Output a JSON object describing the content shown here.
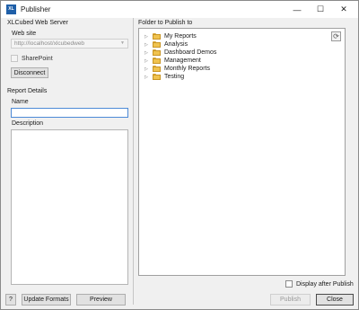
{
  "window": {
    "title": "Publisher",
    "app_icon": "XL",
    "icons": {
      "minimize": "minimize-icon",
      "maximize": "maximize-icon",
      "close": "close-icon"
    }
  },
  "server": {
    "group_label": "XLCubed Web Server",
    "website_label": "Web site",
    "website_value": "http://localhost/xlcubedweb",
    "sharepoint_label": "SharePoint",
    "disconnect_label": "Disconnect"
  },
  "report": {
    "group_label": "Report Details",
    "name_label": "Name",
    "name_value": "",
    "description_label": "Description",
    "description_value": ""
  },
  "publish": {
    "folder_label": "Folder to Publish to",
    "folders": [
      {
        "label": "My Reports"
      },
      {
        "label": "Analysis"
      },
      {
        "label": "Dashboard Demos"
      },
      {
        "label": "Management"
      },
      {
        "label": "Monthly Reports"
      },
      {
        "label": "Testing"
      }
    ],
    "display_after_label": "Display after Publish"
  },
  "footer": {
    "help_label": "?",
    "update_formats_label": "Update Formats",
    "preview_label": "Preview",
    "publish_label": "Publish",
    "close_label": "Close"
  }
}
